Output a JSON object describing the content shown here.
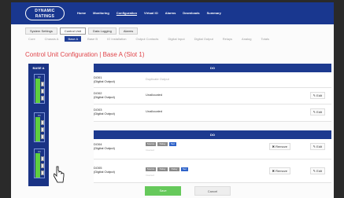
{
  "header": {
    "logo_line1": "DYNAMIC",
    "logo_line2": "RATINGS",
    "nav": [
      "Home",
      "Monitoring",
      "Configuration",
      "Virtual IO",
      "Alarms",
      "Downloads",
      "Summary"
    ]
  },
  "subtabs": [
    "System Settings",
    "Control Unit",
    "Data Logging",
    "Alarms"
  ],
  "basetabs": [
    "Core",
    "Chassis A",
    "Base A",
    "Base B",
    "IO Installation",
    "Output Contacts",
    "Digital Input",
    "Digital Output",
    "Relays",
    "Analog",
    "Totals"
  ],
  "page_title": "Control Unit Configuration | Base A (Slot 1)",
  "rack": {
    "title": "BASE A",
    "cards": [
      "IO",
      "IO",
      "IO"
    ]
  },
  "sections": [
    {
      "title": "DO",
      "rows": [
        {
          "name": "DO01",
          "type": "(Digital Output)",
          "status": "Duplicate Output",
          "edit": "Edit"
        },
        {
          "name": "DO02",
          "type": "(Digital Output)",
          "status": "Unallocated",
          "edit": "Edit"
        },
        {
          "name": "DO03",
          "type": "(Digital Output)",
          "status": "Unallocated",
          "edit": "Edit"
        }
      ]
    },
    {
      "title": "DO",
      "rows": [
        {
          "name": "DO04",
          "type": "(Digital Output)",
          "badges": [
            "Source",
            "Delay",
            "Sec"
          ],
          "subline": "Inverted",
          "remove": "Remove",
          "edit": "Edit"
        },
        {
          "name": "DO05",
          "type": "(Digital Output)",
          "badges": [
            "Source",
            "Delay",
            "Delay",
            "Sec"
          ],
          "subline": "Inverted",
          "remove": "Remove",
          "edit": "Edit"
        }
      ]
    }
  ],
  "footer": {
    "save": "Save",
    "cancel": "Cancel"
  }
}
